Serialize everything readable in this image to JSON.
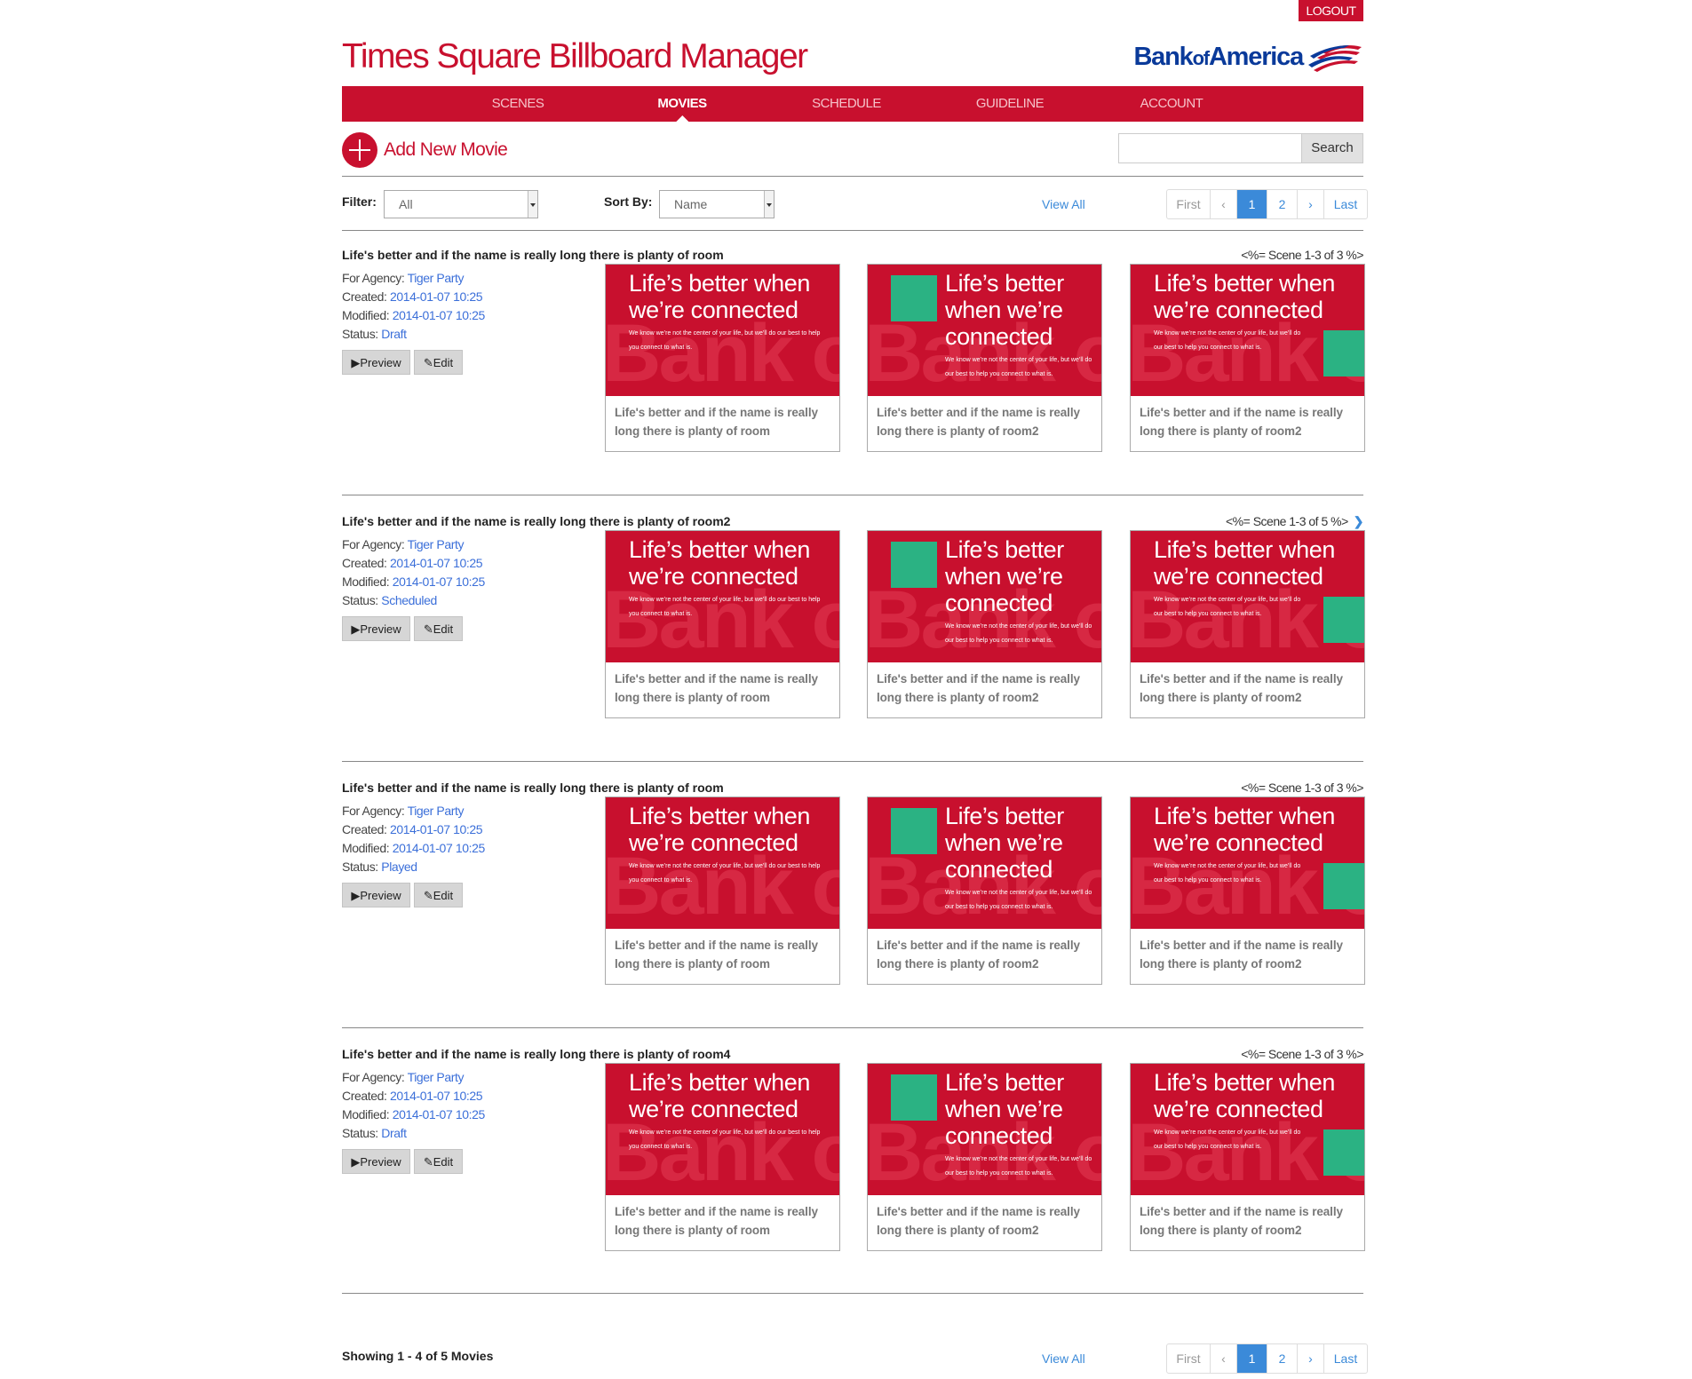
{
  "header": {
    "logout_label": "LOGOUT",
    "app_title": "Times Square Billboard Manager",
    "brand_name": "Bank of America",
    "brand_color": "#c8102e"
  },
  "nav": {
    "items": [
      {
        "label": "SCENES"
      },
      {
        "label": "MOVIES",
        "active": true
      },
      {
        "label": "SCHEDULE"
      },
      {
        "label": "GUIDELINE"
      },
      {
        "label": "ACCOUNT"
      }
    ]
  },
  "toolbar": {
    "add_movie_label": "Add New Movie",
    "search_placeholder": "",
    "search_value": "",
    "search_button": "Search"
  },
  "filters": {
    "filter_label": "Filter:",
    "filter_value": "All",
    "sort_label": "Sort By:",
    "sort_value": "Name",
    "view_all": "View All"
  },
  "pagination": {
    "first": "First",
    "prev": "‹",
    "pages": [
      "1",
      "2"
    ],
    "current": "1",
    "next": "›",
    "last": "Last"
  },
  "labels": {
    "agency": "For Agency:",
    "created": "Created:",
    "modified": "Modified:",
    "status": "Status:",
    "preview": "▶Preview",
    "edit": "✎Edit"
  },
  "thumbnail": {
    "headline_line1": "Life’s better when",
    "headline_line2": "we’re connected",
    "narrow_line1": "Life’s better",
    "narrow_line2": "when we’re",
    "narrow_line3": "connected",
    "body_line1": "We know we’re not the center of your life, but we’ll do our best to help",
    "body_line2": "you connect to what is.",
    "narrow_body_line1": "We know we’re not the center of your life, but we’ll do",
    "narrow_body_line2": "our best to help you connect to what is.",
    "watermark": "Bank of America",
    "accent_color": "#2bb283"
  },
  "movies": [
    {
      "title": "Life's better and if the name is really long there is planty of room",
      "scene_info": "<%= Scene 1-3 of 3 %>",
      "has_next": false,
      "agency": "Tiger Party",
      "created": "2014-01-07 10:25",
      "modified": "2014-01-07 10:25",
      "status": "Draft",
      "scenes": [
        {
          "caption": "Life's better and if the name is really long there is planty of room"
        },
        {
          "caption": "Life's better and if the name is really long there is planty of room2"
        },
        {
          "caption": "Life's better and if the name is really long there is planty of room2"
        }
      ]
    },
    {
      "title": "Life's better and if the name is really long there is planty of room2",
      "scene_info": "<%= Scene 1-3 of 5 %>",
      "has_next": true,
      "agency": "Tiger Party",
      "created": "2014-01-07 10:25",
      "modified": "2014-01-07 10:25",
      "status": "Scheduled",
      "scenes": [
        {
          "caption": "Life's better and if the name is really long there is planty of room"
        },
        {
          "caption": "Life's better and if the name is really long there is planty of room2"
        },
        {
          "caption": "Life's better and if the name is really long there is planty of room2"
        }
      ]
    },
    {
      "title": "Life's better and if the name is really long there is planty of room",
      "scene_info": "<%= Scene 1-3 of 3 %>",
      "has_next": false,
      "agency": "Tiger Party",
      "created": "2014-01-07 10:25",
      "modified": "2014-01-07 10:25",
      "status": "Played",
      "scenes": [
        {
          "caption": "Life's better and if the name is really long there is planty of room"
        },
        {
          "caption": "Life's better and if the name is really long there is planty of room2"
        },
        {
          "caption": "Life's better and if the name is really long there is planty of room2"
        }
      ]
    },
    {
      "title": "Life's better and if the name is really long there is planty of room4",
      "scene_info": "<%= Scene 1-3 of 3 %>",
      "has_next": false,
      "agency": "Tiger Party",
      "created": "2014-01-07 10:25",
      "modified": "2014-01-07 10:25",
      "status": "Draft",
      "scenes": [
        {
          "caption": "Life's better and if the name is really long there is planty of room"
        },
        {
          "caption": "Life's better and if the name is really long there is planty of room2"
        },
        {
          "caption": "Life's better and if the name is really long there is planty of room2"
        }
      ]
    }
  ],
  "footer": {
    "showing": "Showing 1 - 4 of 5 Movies",
    "view_all": "View All"
  }
}
